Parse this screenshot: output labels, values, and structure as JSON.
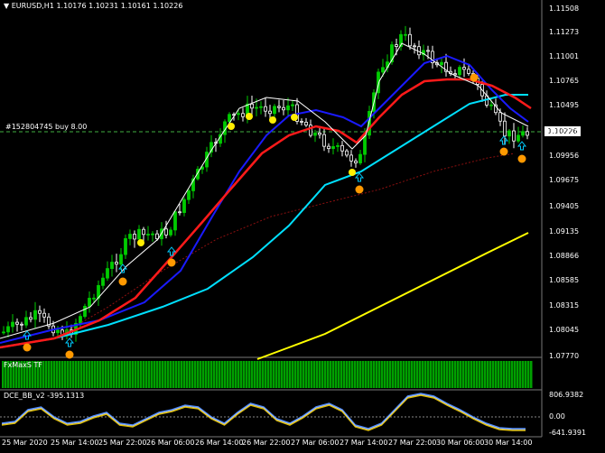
{
  "symbol_header": "EURUSD,H1  1.10176 1.10231 1.10161 1.10226",
  "order_line_label": "#152804745 buy 8.00",
  "current_price": "1.10226",
  "fxmax_label": "FxMaxS TF",
  "dce_label": "DCE_BB_v2 -395.1313",
  "dce_axis": {
    "top": "806.9382",
    "zero": "0.00",
    "bottom": "-641.9391"
  },
  "price_axis": [
    "1.11508",
    "1.11273",
    "1.11001",
    "1.10765",
    "1.10495",
    "1.10226",
    "1.09956",
    "1.09675",
    "1.09405",
    "1.09135",
    "1.08866",
    "1.08585",
    "1.08315",
    "1.08045",
    "1.07770"
  ],
  "time_axis": [
    "25 Mar 2020",
    "25 Mar 14:00",
    "25 Mar 22:00",
    "26 Mar 06:00",
    "26 Mar 14:00",
    "26 Mar 22:00",
    "27 Mar 06:00",
    "27 Mar 14:00",
    "27 Mar 22:00",
    "30 Mar 06:00",
    "30 Mar 14:00"
  ],
  "colors": {
    "bull": "#00cc00",
    "bear": "#ffffff",
    "red": "#ff1a1a",
    "blue": "#1a1aff",
    "cyan": "#00e0ff",
    "yellow": "#ffff00",
    "white": "#ffffff",
    "dot_yellow": "#ffee00",
    "dot_orange": "#ff9900",
    "arrow": "#00ccff",
    "hist": "#00a000",
    "dce_yellow": "#e0c000",
    "dce_blue": "#4d8cff"
  }
}
